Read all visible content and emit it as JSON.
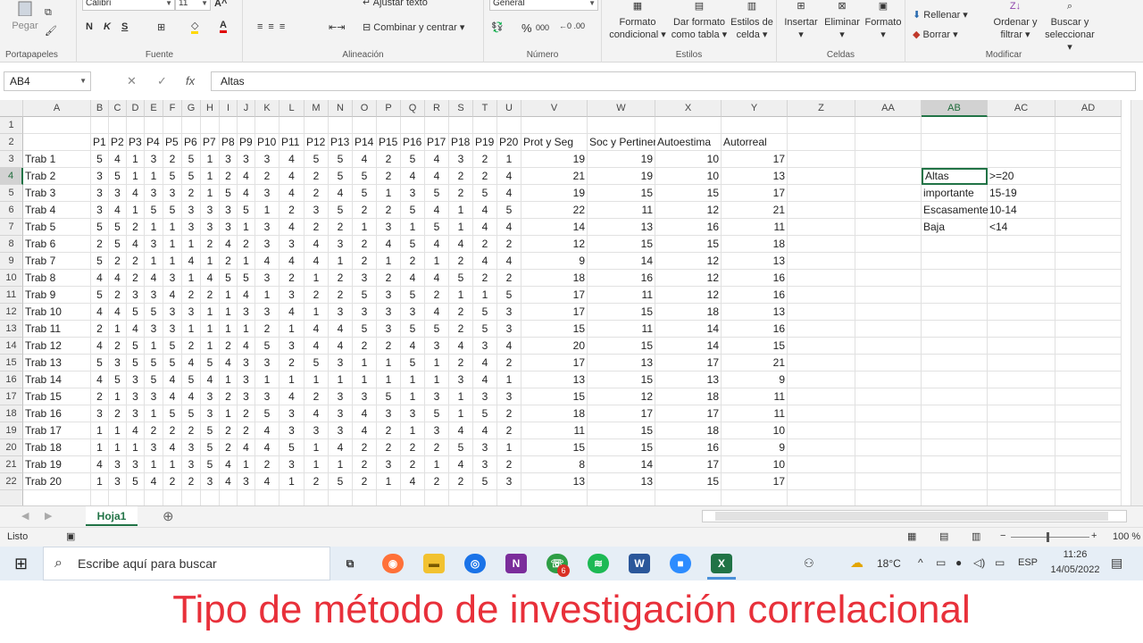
{
  "ribbon": {
    "groups": {
      "portapapeles": "Portapapeles",
      "fuente": "Fuente",
      "alineacion": "Alineación",
      "numero": "Número",
      "estilos": "Estilos",
      "celdas": "Celdas",
      "modificar": "Modificar"
    },
    "pegar": "Pegar",
    "font_name": "Calibri",
    "font_size": "11",
    "ajustar_texto": "Ajustar texto",
    "combinar_centrar": "Combinar y centrar",
    "number_format": "General",
    "formato_condicional_1": "Formato",
    "formato_condicional_2": "condicional",
    "dar_formato_1": "Dar formato",
    "dar_formato_2": "como tabla",
    "estilos_celda_1": "Estilos de",
    "estilos_celda_2": "celda",
    "insertar": "Insertar",
    "eliminar": "Eliminar",
    "formato": "Formato",
    "rellenar": "Rellenar",
    "borrar": "Borrar",
    "ordenar_1": "Ordenar y",
    "ordenar_2": "filtrar",
    "buscar_1": "Buscar y",
    "buscar_2": "seleccionar",
    "bold": "N",
    "italic": "K",
    "underline": "S"
  },
  "formula_bar": {
    "name_box": "AB4",
    "fx": "fx",
    "content": "Altas"
  },
  "columns": [
    "A",
    "B",
    "C",
    "D",
    "E",
    "F",
    "G",
    "H",
    "I",
    "J",
    "K",
    "L",
    "M",
    "N",
    "O",
    "P",
    "Q",
    "R",
    "S",
    "T",
    "U",
    "V",
    "W",
    "X",
    "Y",
    "Z",
    "AA",
    "AB",
    "AC",
    "AD"
  ],
  "header_row": [
    "",
    "P1",
    "P2",
    "P3",
    "P4",
    "P5",
    "P6",
    "P7",
    "P8",
    "P9",
    "P10",
    "P11",
    "P12",
    "P13",
    "P14",
    "P15",
    "P16",
    "P17",
    "P18",
    "P19",
    "P20",
    "Prot y Seg",
    "Soc y Pertinencia",
    "Autoestima",
    "Autorreal"
  ],
  "rows": [
    {
      "name": "Trab 1",
      "p": [
        5,
        4,
        1,
        3,
        2,
        5,
        1,
        3,
        3,
        3,
        4,
        5,
        5,
        4,
        2,
        5,
        4,
        3,
        2,
        1
      ],
      "s": [
        19,
        19,
        10,
        17
      ]
    },
    {
      "name": "Trab 2",
      "p": [
        3,
        5,
        1,
        1,
        5,
        5,
        1,
        2,
        4,
        2,
        4,
        2,
        5,
        5,
        2,
        4,
        4,
        2,
        2,
        4
      ],
      "s": [
        21,
        19,
        10,
        13
      ]
    },
    {
      "name": "Trab 3",
      "p": [
        3,
        3,
        4,
        3,
        3,
        2,
        1,
        5,
        4,
        3,
        4,
        2,
        4,
        5,
        1,
        3,
        5,
        2,
        5,
        4
      ],
      "s": [
        19,
        15,
        15,
        17
      ]
    },
    {
      "name": "Trab 4",
      "p": [
        3,
        4,
        1,
        5,
        5,
        3,
        3,
        3,
        5,
        1,
        2,
        3,
        5,
        2,
        2,
        5,
        4,
        1,
        4,
        5
      ],
      "s": [
        22,
        11,
        12,
        21
      ]
    },
    {
      "name": "Trab 5",
      "p": [
        5,
        5,
        2,
        1,
        1,
        3,
        3,
        3,
        1,
        3,
        4,
        2,
        2,
        1,
        3,
        1,
        5,
        1,
        4,
        4
      ],
      "s": [
        14,
        13,
        16,
        11
      ]
    },
    {
      "name": "Trab 6",
      "p": [
        2,
        5,
        4,
        3,
        1,
        1,
        2,
        4,
        2,
        3,
        3,
        4,
        3,
        2,
        4,
        5,
        4,
        4,
        2,
        2
      ],
      "s": [
        12,
        15,
        15,
        18
      ]
    },
    {
      "name": "Trab 7",
      "p": [
        5,
        2,
        2,
        1,
        1,
        4,
        1,
        2,
        1,
        4,
        4,
        4,
        1,
        2,
        1,
        2,
        1,
        2,
        4,
        4
      ],
      "s": [
        9,
        14,
        12,
        13
      ]
    },
    {
      "name": "Trab 8",
      "p": [
        4,
        4,
        2,
        4,
        3,
        1,
        4,
        5,
        5,
        3,
        2,
        1,
        2,
        3,
        2,
        4,
        4,
        5,
        2,
        2
      ],
      "s": [
        18,
        16,
        12,
        16
      ]
    },
    {
      "name": "Trab 9",
      "p": [
        5,
        2,
        3,
        3,
        4,
        2,
        2,
        1,
        4,
        1,
        3,
        2,
        2,
        5,
        3,
        5,
        2,
        1,
        1,
        5
      ],
      "s": [
        17,
        11,
        12,
        16
      ]
    },
    {
      "name": "Trab 10",
      "p": [
        4,
        4,
        5,
        5,
        3,
        3,
        1,
        1,
        3,
        3,
        4,
        1,
        3,
        3,
        3,
        3,
        4,
        2,
        5,
        3
      ],
      "s": [
        17,
        15,
        18,
        13
      ]
    },
    {
      "name": "Trab 11",
      "p": [
        2,
        1,
        4,
        3,
        3,
        1,
        1,
        1,
        1,
        2,
        1,
        4,
        4,
        5,
        3,
        5,
        5,
        2,
        5,
        3
      ],
      "s": [
        15,
        11,
        14,
        16
      ]
    },
    {
      "name": "Trab 12",
      "p": [
        4,
        2,
        5,
        1,
        5,
        2,
        1,
        2,
        4,
        5,
        3,
        4,
        4,
        2,
        2,
        4,
        3,
        4,
        3,
        4
      ],
      "s": [
        20,
        15,
        14,
        15
      ]
    },
    {
      "name": "Trab 13",
      "p": [
        5,
        3,
        5,
        5,
        5,
        4,
        5,
        4,
        3,
        3,
        2,
        5,
        3,
        1,
        1,
        5,
        1,
        2,
        4,
        2
      ],
      "s": [
        17,
        13,
        17,
        21
      ]
    },
    {
      "name": "Trab 14",
      "p": [
        4,
        5,
        3,
        5,
        4,
        5,
        4,
        1,
        3,
        1,
        1,
        1,
        1,
        1,
        1,
        1,
        1,
        3,
        4,
        1
      ],
      "s": [
        13,
        15,
        13,
        9
      ]
    },
    {
      "name": "Trab 15",
      "p": [
        2,
        1,
        3,
        3,
        4,
        4,
        3,
        2,
        3,
        3,
        4,
        2,
        3,
        3,
        5,
        1,
        3,
        1,
        3,
        3
      ],
      "s": [
        15,
        12,
        18,
        11
      ]
    },
    {
      "name": "Trab 16",
      "p": [
        3,
        2,
        3,
        1,
        5,
        5,
        3,
        1,
        2,
        5,
        3,
        4,
        3,
        4,
        3,
        3,
        5,
        1,
        5,
        2
      ],
      "s": [
        18,
        17,
        17,
        11
      ]
    },
    {
      "name": "Trab 17",
      "p": [
        1,
        1,
        4,
        2,
        2,
        2,
        5,
        2,
        2,
        4,
        3,
        3,
        3,
        4,
        2,
        1,
        3,
        4,
        4,
        2
      ],
      "s": [
        11,
        15,
        18,
        10
      ]
    },
    {
      "name": "Trab 18",
      "p": [
        1,
        1,
        1,
        3,
        4,
        3,
        5,
        2,
        4,
        4,
        5,
        1,
        4,
        2,
        2,
        2,
        2,
        5,
        3,
        1
      ],
      "s": [
        15,
        15,
        16,
        9
      ]
    },
    {
      "name": "Trab 19",
      "p": [
        4,
        3,
        3,
        1,
        1,
        3,
        5,
        4,
        1,
        2,
        3,
        1,
        1,
        2,
        3,
        2,
        1,
        4,
        3,
        2
      ],
      "s": [
        8,
        14,
        17,
        10
      ]
    },
    {
      "name": "Trab 20",
      "p": [
        1,
        3,
        5,
        4,
        2,
        2,
        3,
        4,
        3,
        4,
        1,
        2,
        5,
        2,
        1,
        4,
        2,
        2,
        5,
        3
      ],
      "s": [
        13,
        13,
        15,
        17
      ]
    }
  ],
  "legend": [
    {
      "label": "Altas",
      "range": ">=20"
    },
    {
      "label": "importante",
      "range": "15-19"
    },
    {
      "label": "Escasamente",
      "range": "10-14"
    },
    {
      "label": "Baja",
      "range": "<14"
    }
  ],
  "sheet_tab": "Hoja1",
  "status": {
    "left": "Listo",
    "zoom": "100 %"
  },
  "taskbar": {
    "search_placeholder": "Escribe aquí para buscar",
    "temperature": "18°C",
    "lang": "ESP",
    "time": "11:26",
    "date": "14/05/2022",
    "badge": "6"
  },
  "caption": "Tipo de método de investigación correlacional",
  "colors": {
    "excel_green": "#217346",
    "caption_red": "#e8303a"
  }
}
